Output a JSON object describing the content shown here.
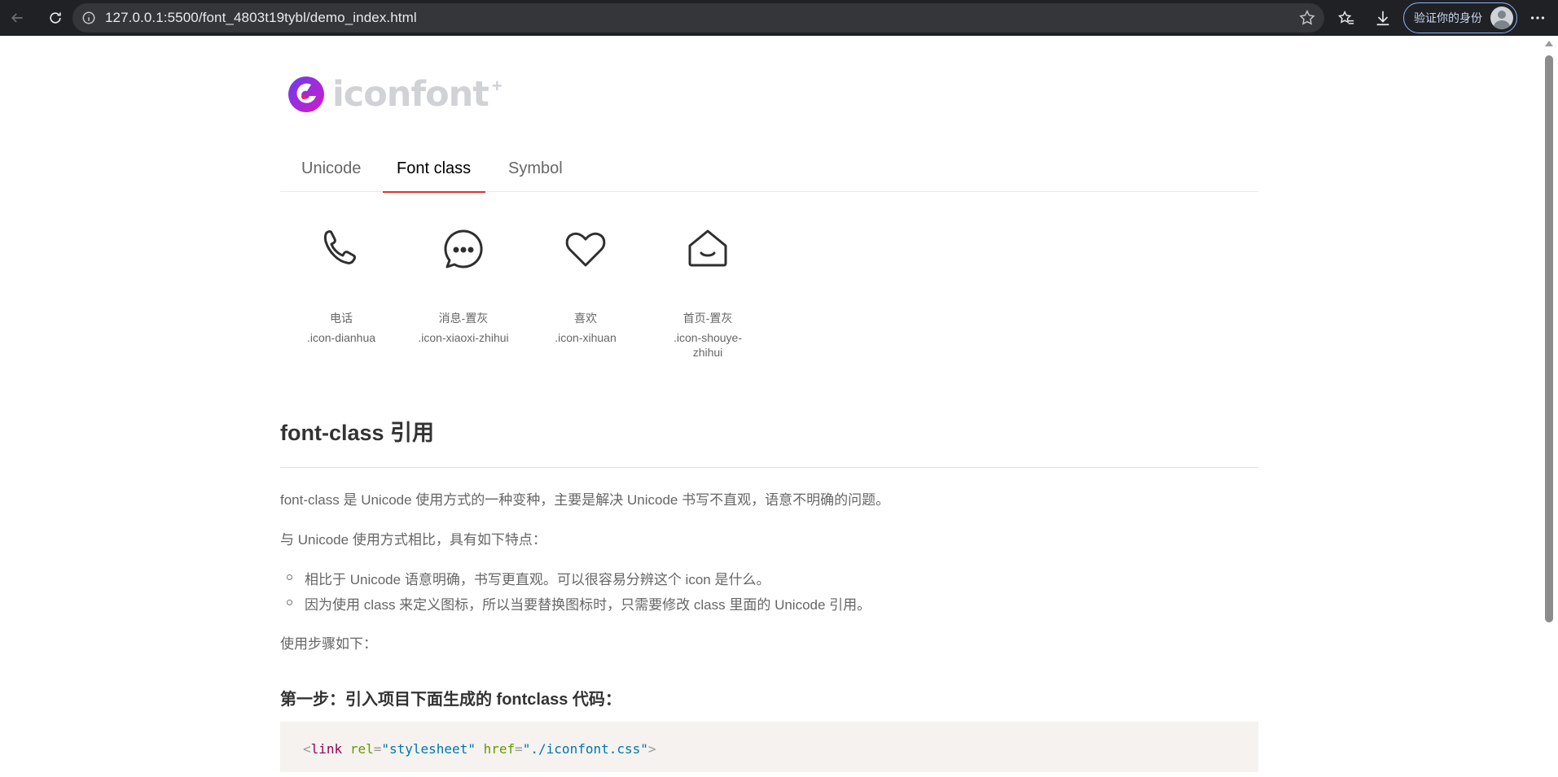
{
  "browser": {
    "url": "127.0.0.1:5500/font_4803t19tybl/demo_index.html",
    "profile_label": "验证你的身份"
  },
  "logo": {
    "text": "iconfont",
    "plus": "+"
  },
  "tabs": [
    {
      "label": "Unicode",
      "active": false
    },
    {
      "label": "Font class",
      "active": true
    },
    {
      "label": "Symbol",
      "active": false
    }
  ],
  "icons": [
    {
      "name": "电话",
      "code": ".icon-dianhua",
      "icon": "phone-icon"
    },
    {
      "name": "消息-置灰",
      "code": ".icon-xiaoxi-zhihui",
      "icon": "message-icon"
    },
    {
      "name": "喜欢",
      "code": ".icon-xihuan",
      "icon": "heart-icon"
    },
    {
      "name": "首页-置灰",
      "code": ".icon-shouye-zhihui",
      "icon": "home-icon"
    }
  ],
  "article": {
    "title": "font-class 引用",
    "intro": "font-class 是 Unicode 使用方式的一种变种，主要是解决 Unicode 书写不直观，语意不明确的问题。",
    "compare": "与 Unicode 使用方式相比，具有如下特点：",
    "bullets": [
      "相比于 Unicode 语意明确，书写更直观。可以很容易分辨这个 icon 是什么。",
      "因为使用 class 来定义图标，所以当要替换图标时，只需要修改 class 里面的 Unicode 引用。"
    ],
    "steps_intro": "使用步骤如下：",
    "step1_title": "第一步：引入项目下面生成的 fontclass 代码：",
    "code": {
      "open": "<",
      "tag": "link",
      "attr1": "rel",
      "eq": "=",
      "val1": "\"stylesheet\"",
      "attr2": "href",
      "val2": "\"./iconfont.css\"",
      "close": ">"
    }
  }
}
